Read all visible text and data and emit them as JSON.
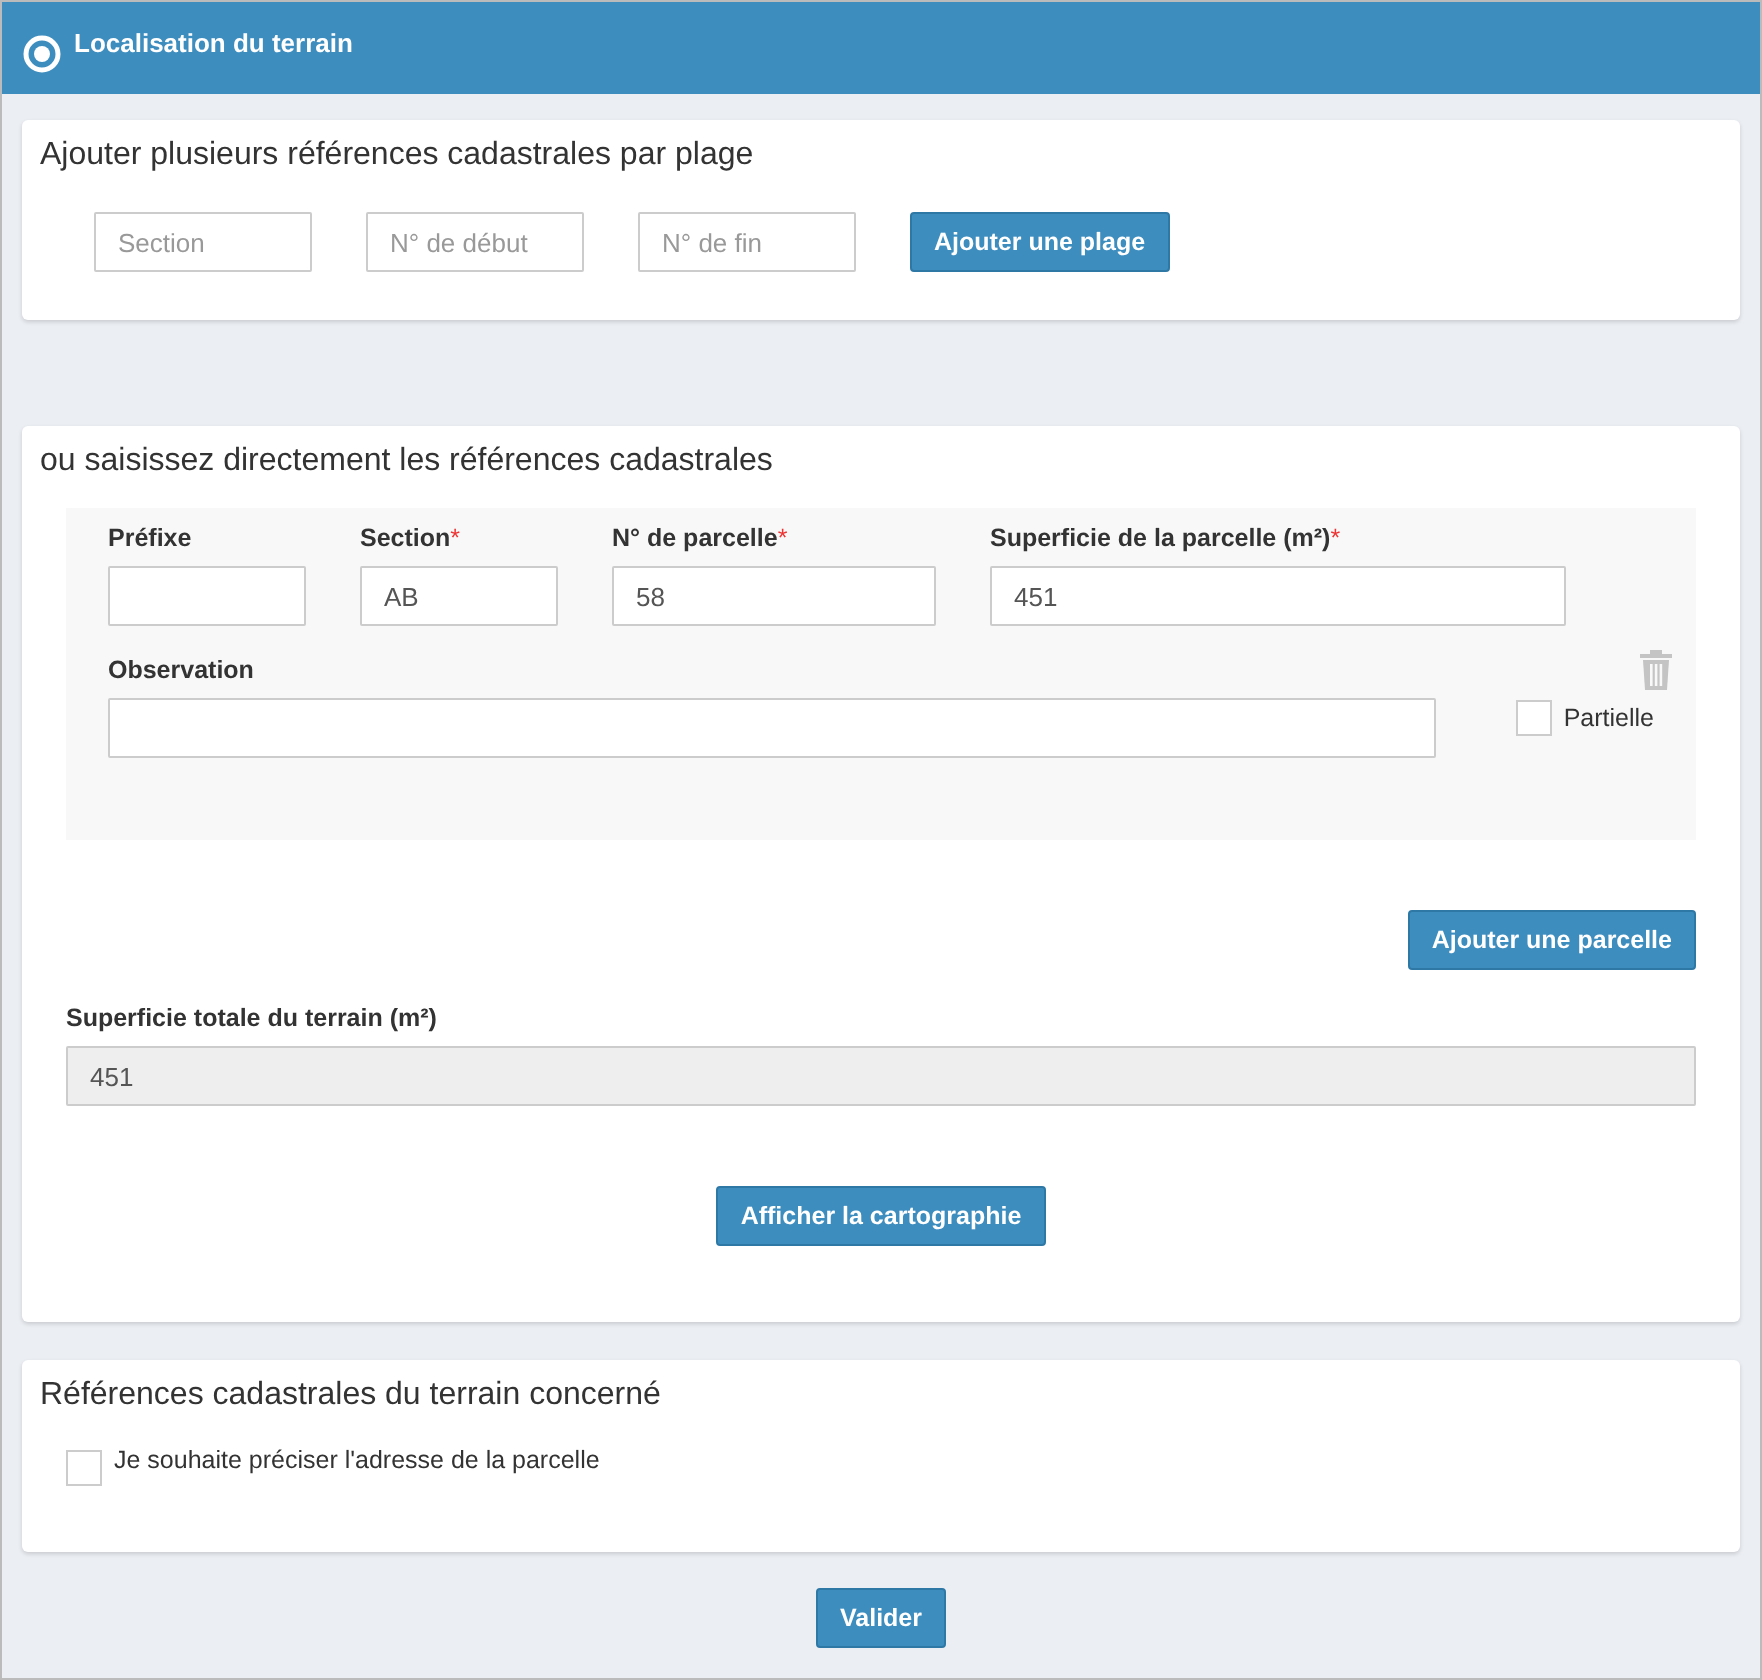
{
  "header": {
    "title": "Localisation du terrain"
  },
  "range_section": {
    "title": "Ajouter plusieurs références cadastrales par plage",
    "fields": [
      {
        "placeholder": "Section"
      },
      {
        "placeholder": "N° de début"
      },
      {
        "placeholder": "N° de fin"
      }
    ],
    "button": "Ajouter une plage"
  },
  "direct_section": {
    "title": "ou saisissez directement les références cadastrales",
    "parcel": {
      "fields": [
        {
          "label": "Préfixe"
        },
        {
          "label": "Section",
          "required_mark": "*",
          "value": "AB"
        },
        {
          "label": "N° de parcelle",
          "required_mark": "*",
          "value": "58"
        },
        {
          "label": "Superficie de la parcelle (m²)",
          "required_mark": "*",
          "value": "451"
        }
      ],
      "observation": {
        "label": "Observation"
      },
      "partial": {
        "label": "Partielle",
        "checked": false
      }
    },
    "add_button": "Ajouter une parcelle",
    "total": {
      "label": "Superficie totale du terrain (m²)",
      "value": "451"
    },
    "map_button": "Afficher la cartographie"
  },
  "references_section": {
    "title": "Références cadastrales du terrain concerné",
    "address_checkbox": {
      "label": "Je souhaite préciser l'adresse de la parcelle",
      "checked": false
    }
  },
  "submit_button": "Valider"
}
